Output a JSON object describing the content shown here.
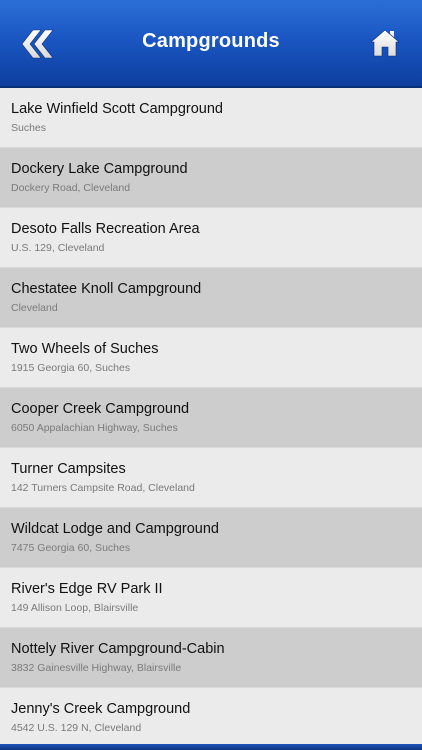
{
  "header": {
    "title": "Campgrounds",
    "back_icon": "double-chevron-left-icon",
    "home_icon": "home-icon"
  },
  "colors": {
    "header_top": "#2b6fd6",
    "header_bottom": "#0d3f9e",
    "row_light": "#ebebeb",
    "row_dark": "#cdcdcd"
  },
  "campgrounds": [
    {
      "name": "Lake Winfield Scott Campground",
      "address": "Suches"
    },
    {
      "name": "Dockery Lake Campground",
      "address": "Dockery Road, Cleveland"
    },
    {
      "name": "Desoto Falls Recreation Area",
      "address": "U.S. 129, Cleveland"
    },
    {
      "name": "Chestatee Knoll Campground",
      "address": "Cleveland"
    },
    {
      "name": "Two Wheels of Suches",
      "address": "1915 Georgia 60, Suches"
    },
    {
      "name": "Cooper Creek Campground",
      "address": "6050 Appalachian Highway, Suches"
    },
    {
      "name": "Turner Campsites",
      "address": "142 Turners Campsite Road, Cleveland"
    },
    {
      "name": "Wildcat Lodge and Campground",
      "address": "7475 Georgia 60, Suches"
    },
    {
      "name": "River's Edge RV Park II",
      "address": "149 Allison Loop, Blairsville"
    },
    {
      "name": "Nottely River Campground-Cabin",
      "address": "3832 Gainesville Highway, Blairsville"
    },
    {
      "name": "Jenny's Creek Campground",
      "address": "4542 U.S. 129 N, Cleveland"
    }
  ]
}
